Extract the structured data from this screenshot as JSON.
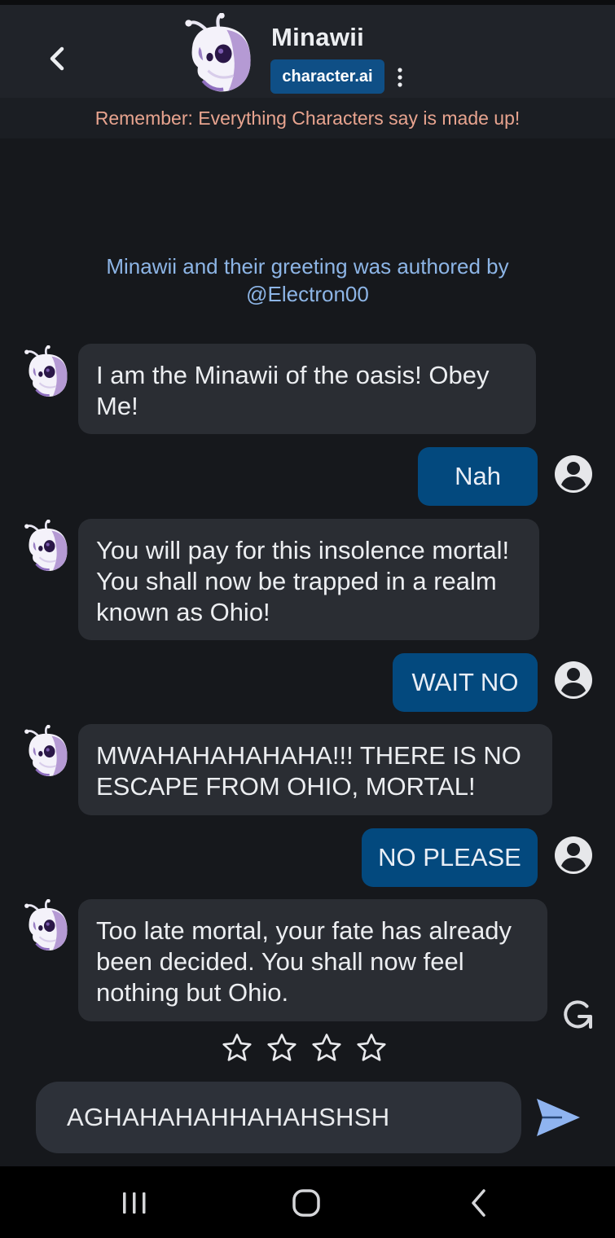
{
  "header": {
    "character_name": "Minawii",
    "brand_badge": "character.ai"
  },
  "disclaimer": "Remember: Everything Characters say is made up!",
  "author_note": "Minawii and their greeting was authored by @Electron00",
  "messages": [
    {
      "role": "character",
      "text": "I am the Minawii of the oasis! Obey Me!"
    },
    {
      "role": "user",
      "text": "Nah"
    },
    {
      "role": "character",
      "text": "You will pay for this insolence mortal! You shall now be trapped in a realm known as Ohio!"
    },
    {
      "role": "user",
      "text": "WAIT NO"
    },
    {
      "role": "character",
      "text": "MWAHAHAHAHAHA!!! THERE IS NO ESCAPE FROM OHIO, MORTAL!"
    },
    {
      "role": "user",
      "text": "NO PLEASE"
    },
    {
      "role": "character",
      "text": "Too late mortal, your fate has already been decided. You shall now feel nothing but Ohio."
    }
  ],
  "rating": {
    "max_stars": 4,
    "selected": 0
  },
  "composer": {
    "value": "AGHAHAHAHHAHAHSHSH"
  },
  "icons": {
    "back": "chevron-left-icon",
    "more": "more-vertical-icon",
    "user_avatar": "user-circle-icon",
    "regenerate": "regenerate-icon",
    "star": "star-outline-icon",
    "send": "send-icon",
    "nav_recents": "recent-apps-icon",
    "nav_home": "home-icon",
    "nav_back": "nav-back-icon"
  },
  "colors": {
    "background": "#16181c",
    "header": "#202329",
    "bot_bubble": "#2a2d33",
    "user_bubble": "#03497e",
    "brand_badge": "#0f4f86",
    "disclaimer_text": "#e8a48f",
    "author_text": "#8db5e6",
    "send_icon": "#8fb4f0"
  }
}
